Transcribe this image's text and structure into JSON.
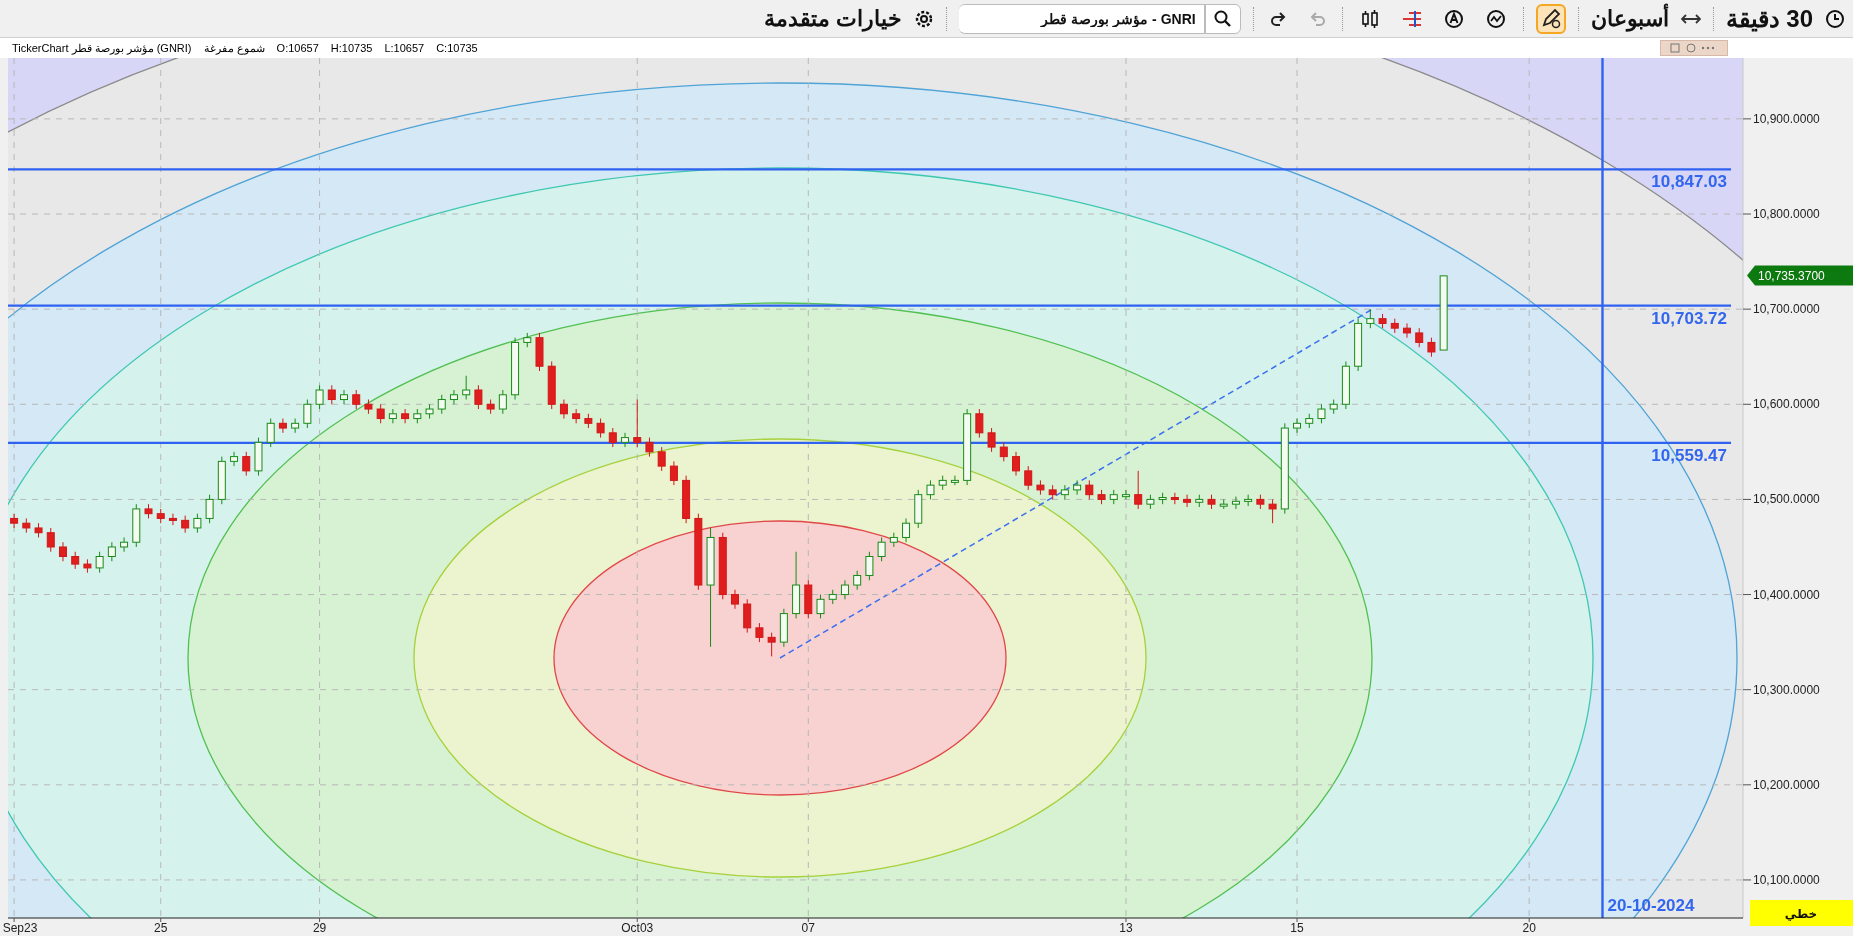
{
  "toolbar": {
    "interval": "30 دقيقة",
    "range": "أسبوعان",
    "tools": [
      {
        "kind": "drawing",
        "selected": true
      },
      {
        "kind": "indicator",
        "selected": false
      },
      {
        "kind": "autoscale",
        "selected": false
      },
      {
        "kind": "levels",
        "selected": false
      },
      {
        "kind": "candles",
        "selected": false
      }
    ],
    "history": [
      {
        "kind": "undo",
        "disabled": true
      },
      {
        "kind": "redo",
        "disabled": false
      }
    ],
    "symbol_field": {
      "value": "GNRI - مؤشر بورصة قطر"
    },
    "options": "خيارات متقدمة"
  },
  "info": {
    "title": "TickerChart مؤشر بورصة قطر (GNRI)",
    "chart_type": "شموع مفرغة",
    "open": "O:10657",
    "high": "H:10735",
    "low": "L:10657",
    "close": "C:10735"
  },
  "chart": {
    "chart_data": {
      "type": "candlestick",
      "ylim": [
        10060,
        10964
      ],
      "grid": true,
      "categories": [
        "Sep23",
        null,
        null,
        null,
        null,
        null,
        null,
        null,
        null,
        null,
        null,
        null,
        "25",
        null,
        null,
        null,
        null,
        null,
        null,
        null,
        null,
        null,
        null,
        null,
        null,
        "29",
        null,
        null,
        null,
        null,
        null,
        null,
        null,
        null,
        null,
        null,
        null,
        null,
        null,
        null,
        null,
        null,
        null,
        null,
        null,
        null,
        null,
        null,
        null,
        null,
        null,
        "Oct03",
        null,
        null,
        null,
        null,
        null,
        null,
        null,
        null,
        null,
        null,
        null,
        null,
        null,
        "07",
        null,
        null,
        null,
        null,
        null,
        null,
        null,
        null,
        null,
        null,
        null,
        null,
        null,
        null,
        null,
        null,
        null,
        null,
        null,
        null,
        null,
        null,
        null,
        null,
        null,
        "13",
        null,
        null,
        null,
        null,
        null,
        null,
        null,
        null,
        null,
        null,
        null,
        null,
        null,
        "15",
        null,
        null,
        null,
        null,
        null,
        null,
        null,
        null,
        null,
        null,
        null,
        null,
        null,
        null,
        null,
        null,
        null,
        null,
        "20",
        null,
        null,
        null,
        null,
        null,
        null,
        null,
        null,
        null,
        null,
        null,
        null,
        null,
        null,
        null,
        null,
        null
      ],
      "ref_lines": [
        {
          "axis": "y",
          "value": 10847.03,
          "label": "10,847.03"
        },
        {
          "axis": "y",
          "value": 10703.72,
          "label": "10,703.72"
        },
        {
          "axis": "y",
          "value": 10559.47,
          "label": "10,559.47"
        }
      ],
      "yticks": [
        {
          "value": 10100,
          "label": "10,100.0000"
        },
        {
          "value": 10200,
          "label": "10,200.0000"
        },
        {
          "value": 10300,
          "label": "10,300.0000"
        },
        {
          "value": 10400,
          "label": "10,400.0000"
        },
        {
          "value": 10500,
          "label": "10,500.0000"
        },
        {
          "value": 10600,
          "label": "10,600.0000"
        },
        {
          "value": 10700,
          "label": "10,700.0000"
        },
        {
          "value": 10800,
          "label": "10,800.0000"
        },
        {
          "value": 10900,
          "label": "10,900.0000"
        }
      ],
      "ohlc": [
        [
          10480,
          10485,
          10470,
          10475
        ],
        [
          10475,
          10480,
          10465,
          10470
        ],
        [
          10470,
          10475,
          10460,
          10465
        ],
        [
          10465,
          10470,
          10445,
          10450
        ],
        [
          10450,
          10455,
          10435,
          10440
        ],
        [
          10440,
          10445,
          10427,
          10432
        ],
        [
          10432,
          10437,
          10423,
          10428
        ],
        [
          10428,
          10445,
          10423,
          10440
        ],
        [
          10440,
          10455,
          10435,
          10450
        ],
        [
          10450,
          10460,
          10445,
          10455
        ],
        [
          10455,
          10495,
          10450,
          10490
        ],
        [
          10490,
          10495,
          10480,
          10485
        ],
        [
          10485,
          10490,
          10475,
          10480
        ],
        [
          10480,
          10485,
          10473,
          10478
        ],
        [
          10478,
          10483,
          10465,
          10470
        ],
        [
          10470,
          10485,
          10465,
          10480
        ],
        [
          10480,
          10505,
          10475,
          10500
        ],
        [
          10500,
          10545,
          10495,
          10540
        ],
        [
          10540,
          10550,
          10535,
          10545
        ],
        [
          10545,
          10550,
          10525,
          10530
        ],
        [
          10530,
          10565,
          10525,
          10560
        ],
        [
          10560,
          10585,
          10555,
          10580
        ],
        [
          10580,
          10585,
          10570,
          10575
        ],
        [
          10575,
          10585,
          10570,
          10580
        ],
        [
          10580,
          10605,
          10575,
          10600
        ],
        [
          10600,
          10620,
          10595,
          10615
        ],
        [
          10615,
          10620,
          10600,
          10605
        ],
        [
          10605,
          10615,
          10600,
          10610
        ],
        [
          10610,
          10615,
          10595,
          10600
        ],
        [
          10600,
          10605,
          10590,
          10595
        ],
        [
          10595,
          10600,
          10580,
          10585
        ],
        [
          10585,
          10595,
          10580,
          10590
        ],
        [
          10590,
          10595,
          10580,
          10585
        ],
        [
          10585,
          10595,
          10580,
          10590
        ],
        [
          10590,
          10600,
          10585,
          10595
        ],
        [
          10595,
          10610,
          10590,
          10605
        ],
        [
          10605,
          10615,
          10600,
          10610
        ],
        [
          10610,
          10630,
          10605,
          10615
        ],
        [
          10615,
          10620,
          10595,
          10600
        ],
        [
          10600,
          10605,
          10590,
          10595
        ],
        [
          10595,
          10615,
          10590,
          10610
        ],
        [
          10610,
          10670,
          10605,
          10665
        ],
        [
          10665,
          10675,
          10660,
          10670
        ],
        [
          10670,
          10675,
          10635,
          10640
        ],
        [
          10640,
          10645,
          10595,
          10600
        ],
        [
          10600,
          10605,
          10585,
          10590
        ],
        [
          10590,
          10595,
          10580,
          10585
        ],
        [
          10585,
          10590,
          10575,
          10580
        ],
        [
          10580,
          10585,
          10565,
          10570
        ],
        [
          10570,
          10575,
          10555,
          10560
        ],
        [
          10560,
          10570,
          10555,
          10565
        ],
        [
          10565,
          10605,
          10555,
          10560
        ],
        [
          10560,
          10565,
          10545,
          10550
        ],
        [
          10550,
          10555,
          10530,
          10535
        ],
        [
          10535,
          10540,
          10515,
          10520
        ],
        [
          10520,
          10525,
          10475,
          10480
        ],
        [
          10480,
          10485,
          10405,
          10410
        ],
        [
          10410,
          10470,
          10345,
          10460
        ],
        [
          10460,
          10465,
          10395,
          10400
        ],
        [
          10400,
          10405,
          10385,
          10390
        ],
        [
          10390,
          10395,
          10360,
          10365
        ],
        [
          10365,
          10370,
          10350,
          10355
        ],
        [
          10355,
          10360,
          10335,
          10350
        ],
        [
          10350,
          10385,
          10345,
          10380
        ],
        [
          10380,
          10445,
          10375,
          10410
        ],
        [
          10410,
          10415,
          10375,
          10380
        ],
        [
          10380,
          10400,
          10375,
          10395
        ],
        [
          10395,
          10405,
          10390,
          10400
        ],
        [
          10400,
          10415,
          10395,
          10410
        ],
        [
          10410,
          10425,
          10405,
          10420
        ],
        [
          10420,
          10445,
          10415,
          10440
        ],
        [
          10440,
          10460,
          10435,
          10455
        ],
        [
          10455,
          10465,
          10450,
          10460
        ],
        [
          10460,
          10480,
          10455,
          10475
        ],
        [
          10475,
          10510,
          10470,
          10505
        ],
        [
          10505,
          10520,
          10500,
          10515
        ],
        [
          10515,
          10525,
          10510,
          10520
        ],
        [
          10520,
          10525,
          10515,
          10520
        ],
        [
          10520,
          10595,
          10515,
          10590
        ],
        [
          10590,
          10595,
          10565,
          10570
        ],
        [
          10570,
          10575,
          10550,
          10555
        ],
        [
          10555,
          10560,
          10540,
          10545
        ],
        [
          10545,
          10550,
          10525,
          10530
        ],
        [
          10530,
          10535,
          10510,
          10515
        ],
        [
          10515,
          10520,
          10505,
          10510
        ],
        [
          10510,
          10515,
          10500,
          10505
        ],
        [
          10505,
          10515,
          10500,
          10510
        ],
        [
          10510,
          10520,
          10505,
          10515
        ],
        [
          10515,
          10520,
          10500,
          10505
        ],
        [
          10505,
          10510,
          10495,
          10500
        ],
        [
          10500,
          10510,
          10495,
          10505
        ],
        [
          10505,
          10510,
          10500,
          10505
        ],
        [
          10505,
          10530,
          10490,
          10495
        ],
        [
          10495,
          10505,
          10490,
          10500
        ],
        [
          10500,
          10507,
          10495,
          10502
        ],
        [
          10502,
          10507,
          10495,
          10500
        ],
        [
          10500,
          10505,
          10492,
          10497
        ],
        [
          10497,
          10505,
          10492,
          10500
        ],
        [
          10500,
          10505,
          10490,
          10495
        ],
        [
          10495,
          10500,
          10490,
          10495
        ],
        [
          10495,
          10503,
          10490,
          10498
        ],
        [
          10498,
          10505,
          10493,
          10500
        ],
        [
          10500,
          10505,
          10490,
          10495
        ],
        [
          10495,
          10500,
          10475,
          10490
        ],
        [
          10490,
          10580,
          10485,
          10575
        ],
        [
          10575,
          10585,
          10570,
          10580
        ],
        [
          10580,
          10590,
          10575,
          10585
        ],
        [
          10585,
          10600,
          10580,
          10595
        ],
        [
          10595,
          10605,
          10590,
          10600
        ],
        [
          10600,
          10645,
          10595,
          10640
        ],
        [
          10640,
          10690,
          10635,
          10685
        ],
        [
          10685,
          10700,
          10680,
          10690
        ],
        [
          10690,
          10695,
          10680,
          10685
        ],
        [
          10685,
          10690,
          10675,
          10680
        ],
        [
          10680,
          10685,
          10670,
          10675
        ],
        [
          10675,
          10680,
          10660,
          10665
        ],
        [
          10665,
          10670,
          10650,
          10655
        ],
        [
          10657,
          10735,
          10657,
          10735
        ],
        null,
        null,
        null,
        null,
        null,
        null,
        null,
        null,
        null,
        null,
        null,
        null,
        null,
        null,
        null,
        null,
        null,
        null,
        null,
        null,
        null,
        null,
        null,
        null
      ]
    },
    "date_marker": "20-10-2024",
    "last_price": "10,735.3700",
    "scale_mode": "خطي"
  }
}
